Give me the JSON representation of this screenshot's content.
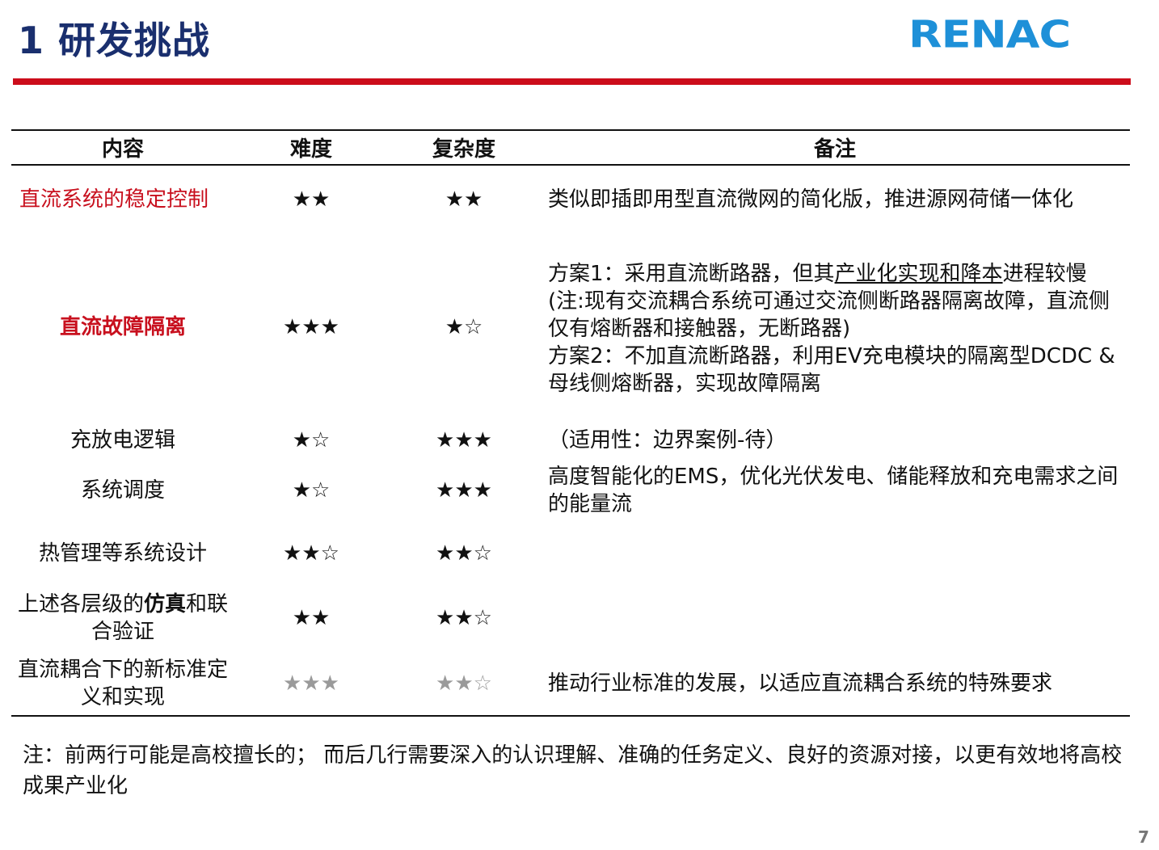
{
  "header": {
    "title": "1 研发挑战",
    "logo_text": "RENAC"
  },
  "colors": {
    "title": "#1a2f6e",
    "accent_red": "#cc0d1b",
    "logo_blue": "#1e90d8"
  },
  "table": {
    "headers": [
      "内容",
      "难度",
      "复杂度",
      "备注"
    ],
    "rows": [
      {
        "content": "直流系统的稳定控制",
        "difficulty": "★★",
        "complexity": "★★",
        "note": "类似即插即用型直流微网的简化版，推进源网荷储一体化"
      },
      {
        "content": "直流故障隔离",
        "difficulty": "★★★",
        "complexity": "★☆",
        "note_lines": [
          {
            "a": "方案1：采用直流断路器，但其",
            "u": "产业化实现和降本",
            "b": "进程较慢"
          },
          "(注:现有交流耦合系统可通过交流侧断路器隔离故障，直流侧仅有熔断器和接触器，无断路器)",
          "方案2：不加直流断路器，利用EV充电模块的隔离型DCDC & 母线侧熔断器，实现故障隔离"
        ]
      },
      {
        "content": "充放电逻辑",
        "difficulty": "★☆",
        "complexity": "★★★",
        "note": "（适用性：边界案例-待）"
      },
      {
        "content": "系统调度",
        "difficulty": "★☆",
        "complexity": "★★★",
        "note": "高度智能化的EMS，优化光伏发电、储能释放和充电需求之间的能量流"
      },
      {
        "content": "热管理等系统设计",
        "difficulty": "★★☆",
        "complexity": "★★☆",
        "note": ""
      },
      {
        "content_a": "上述各层级的",
        "content_bold": "仿真",
        "content_b": "和联合验证",
        "difficulty": "★★",
        "complexity": "★★☆",
        "note": ""
      },
      {
        "content": "直流耦合下的新标准定义和实现",
        "difficulty": "★★★",
        "complexity": "★★☆",
        "note": "推动行业标准的发展，以适应直流耦合系统的特殊要求"
      }
    ]
  },
  "footnote": "注：前两行可能是高校擅长的；  而后几行需要深入的认识理解、准确的任务定义、良好的资源对接，以更有效地将高校成果产业化",
  "page_number": "7"
}
